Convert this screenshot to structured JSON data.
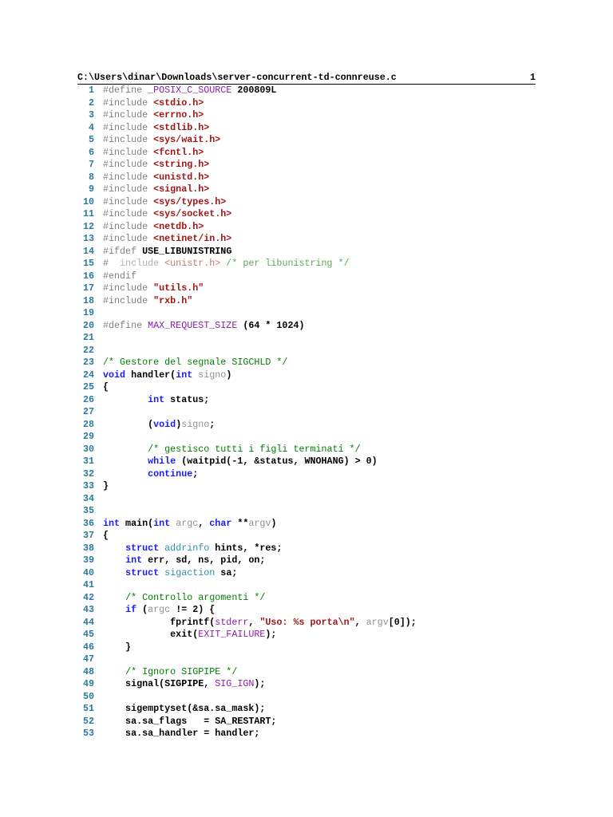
{
  "header": {
    "path": "C:\\Users\\dinar\\Downloads\\server-concurrent-td-connreuse.c",
    "page": "1"
  },
  "lines": [
    {
      "n": "1",
      "t": [
        [
          "p",
          "#define "
        ],
        [
          "m",
          "_POSIX_C_SOURCE"
        ],
        [
          "n",
          " 200809L"
        ]
      ]
    },
    {
      "n": "2",
      "t": [
        [
          "p",
          "#include "
        ],
        [
          "s",
          "<stdio.h>"
        ]
      ]
    },
    {
      "n": "3",
      "t": [
        [
          "p",
          "#include "
        ],
        [
          "s",
          "<errno.h>"
        ]
      ]
    },
    {
      "n": "4",
      "t": [
        [
          "p",
          "#include "
        ],
        [
          "s",
          "<stdlib.h>"
        ]
      ]
    },
    {
      "n": "5",
      "t": [
        [
          "p",
          "#include "
        ],
        [
          "s",
          "<sys/wait.h>"
        ]
      ]
    },
    {
      "n": "6",
      "t": [
        [
          "p",
          "#include "
        ],
        [
          "s",
          "<fcntl.h>"
        ]
      ]
    },
    {
      "n": "7",
      "t": [
        [
          "p",
          "#include "
        ],
        [
          "s",
          "<string.h>"
        ]
      ]
    },
    {
      "n": "8",
      "t": [
        [
          "p",
          "#include "
        ],
        [
          "s",
          "<unistd.h>"
        ]
      ]
    },
    {
      "n": "9",
      "t": [
        [
          "p",
          "#include "
        ],
        [
          "s",
          "<signal.h>"
        ]
      ]
    },
    {
      "n": "10",
      "t": [
        [
          "p",
          "#include "
        ],
        [
          "s",
          "<sys/types.h>"
        ]
      ]
    },
    {
      "n": "11",
      "t": [
        [
          "p",
          "#include "
        ],
        [
          "s",
          "<sys/socket.h>"
        ]
      ]
    },
    {
      "n": "12",
      "t": [
        [
          "p",
          "#include "
        ],
        [
          "s",
          "<netdb.h>"
        ]
      ]
    },
    {
      "n": "13",
      "t": [
        [
          "p",
          "#include "
        ],
        [
          "s",
          "<netinet/in.h>"
        ]
      ]
    },
    {
      "n": "14",
      "t": [
        [
          "p",
          "#ifdef "
        ],
        [
          "n",
          "USE_LIBUNISTRING"
        ]
      ]
    },
    {
      "n": "15",
      "t": [
        [
          "p",
          "#  "
        ],
        [
          "i",
          "include "
        ],
        [
          "is",
          "<unistr.h>"
        ],
        [
          "ic",
          " /* per libunistring */"
        ]
      ]
    },
    {
      "n": "16",
      "t": [
        [
          "p",
          "#endif"
        ]
      ]
    },
    {
      "n": "17",
      "t": [
        [
          "p",
          "#include "
        ],
        [
          "s",
          "\"utils.h\""
        ]
      ]
    },
    {
      "n": "18",
      "t": [
        [
          "p",
          "#include "
        ],
        [
          "s",
          "\"rxb.h\""
        ]
      ]
    },
    {
      "n": "19",
      "t": []
    },
    {
      "n": "20",
      "t": [
        [
          "p",
          "#define "
        ],
        [
          "m",
          "MAX_REQUEST_SIZE"
        ],
        [
          "n",
          " (64 * 1024)"
        ]
      ]
    },
    {
      "n": "21",
      "t": []
    },
    {
      "n": "22",
      "t": []
    },
    {
      "n": "23",
      "t": [
        [
          "c",
          "/* Gestore del segnale SIGCHLD */"
        ]
      ]
    },
    {
      "n": "24",
      "t": [
        [
          "k",
          "void"
        ],
        [
          "n",
          " handler("
        ],
        [
          "k",
          "int"
        ],
        [
          "v",
          " signo"
        ],
        [
          "n",
          ")"
        ]
      ]
    },
    {
      "n": "25",
      "t": [
        [
          "n",
          "{"
        ]
      ]
    },
    {
      "n": "26",
      "t": [
        [
          "n",
          "        "
        ],
        [
          "k",
          "int"
        ],
        [
          "n",
          " status;"
        ]
      ]
    },
    {
      "n": "27",
      "t": []
    },
    {
      "n": "28",
      "t": [
        [
          "n",
          "        ("
        ],
        [
          "k",
          "void"
        ],
        [
          "n",
          ")"
        ],
        [
          "v",
          "signo"
        ],
        [
          "n",
          ";"
        ]
      ]
    },
    {
      "n": "29",
      "t": []
    },
    {
      "n": "30",
      "t": [
        [
          "n",
          "        "
        ],
        [
          "c",
          "/* gestisco tutti i figli terminati */"
        ]
      ]
    },
    {
      "n": "31",
      "t": [
        [
          "n",
          "        "
        ],
        [
          "k",
          "while"
        ],
        [
          "n",
          " (waitpid(-1, &status, WNOHANG) > 0)"
        ]
      ]
    },
    {
      "n": "32",
      "t": [
        [
          "n",
          "        "
        ],
        [
          "k",
          "continue"
        ],
        [
          "n",
          ";"
        ]
      ]
    },
    {
      "n": "33",
      "t": [
        [
          "n",
          "}"
        ]
      ]
    },
    {
      "n": "34",
      "t": []
    },
    {
      "n": "35",
      "t": []
    },
    {
      "n": "36",
      "t": [
        [
          "k",
          "int"
        ],
        [
          "n",
          " main("
        ],
        [
          "k",
          "int"
        ],
        [
          "v",
          " argc"
        ],
        [
          "n",
          ", "
        ],
        [
          "k",
          "char"
        ],
        [
          "n",
          " **"
        ],
        [
          "v",
          "argv"
        ],
        [
          "n",
          ")"
        ]
      ]
    },
    {
      "n": "37",
      "t": [
        [
          "n",
          "{"
        ]
      ]
    },
    {
      "n": "38",
      "t": [
        [
          "n",
          "    "
        ],
        [
          "k",
          "struct"
        ],
        [
          "t",
          " addrinfo"
        ],
        [
          "n",
          " hints, *res;"
        ]
      ]
    },
    {
      "n": "39",
      "t": [
        [
          "n",
          "    "
        ],
        [
          "k",
          "int"
        ],
        [
          "n",
          " err, sd, ns, pid, on;"
        ]
      ]
    },
    {
      "n": "40",
      "t": [
        [
          "n",
          "    "
        ],
        [
          "k",
          "struct"
        ],
        [
          "t",
          " sigaction"
        ],
        [
          "n",
          " sa;"
        ]
      ]
    },
    {
      "n": "41",
      "t": []
    },
    {
      "n": "42",
      "t": [
        [
          "n",
          "    "
        ],
        [
          "c",
          "/* Controllo argomenti */"
        ]
      ]
    },
    {
      "n": "43",
      "t": [
        [
          "n",
          "    "
        ],
        [
          "k",
          "if"
        ],
        [
          "n",
          " ("
        ],
        [
          "v",
          "argc"
        ],
        [
          "n",
          " != 2) {"
        ]
      ]
    },
    {
      "n": "44",
      "t": [
        [
          "n",
          "            fprintf("
        ],
        [
          "m",
          "stderr"
        ],
        [
          "n",
          ", "
        ],
        [
          "s",
          "\"Uso: %s porta\\n\""
        ],
        [
          "n",
          ", "
        ],
        [
          "v",
          "argv"
        ],
        [
          "n",
          "[0]);"
        ]
      ]
    },
    {
      "n": "45",
      "t": [
        [
          "n",
          "            exit("
        ],
        [
          "m",
          "EXIT_FAILURE"
        ],
        [
          "n",
          ");"
        ]
      ]
    },
    {
      "n": "46",
      "t": [
        [
          "n",
          "    }"
        ]
      ]
    },
    {
      "n": "47",
      "t": []
    },
    {
      "n": "48",
      "t": [
        [
          "n",
          "    "
        ],
        [
          "c",
          "/* Ignoro SIGPIPE */"
        ]
      ]
    },
    {
      "n": "49",
      "t": [
        [
          "n",
          "    signal(SIGPIPE, "
        ],
        [
          "m",
          "SIG_IGN"
        ],
        [
          "n",
          ");"
        ]
      ]
    },
    {
      "n": "50",
      "t": []
    },
    {
      "n": "51",
      "t": [
        [
          "n",
          "    sigemptyset(&sa.sa_mask);"
        ]
      ]
    },
    {
      "n": "52",
      "t": [
        [
          "n",
          "    sa.sa_flags   = SA_RESTART;"
        ]
      ]
    },
    {
      "n": "53",
      "t": [
        [
          "n",
          "    sa.sa_handler = handler;"
        ]
      ]
    }
  ]
}
